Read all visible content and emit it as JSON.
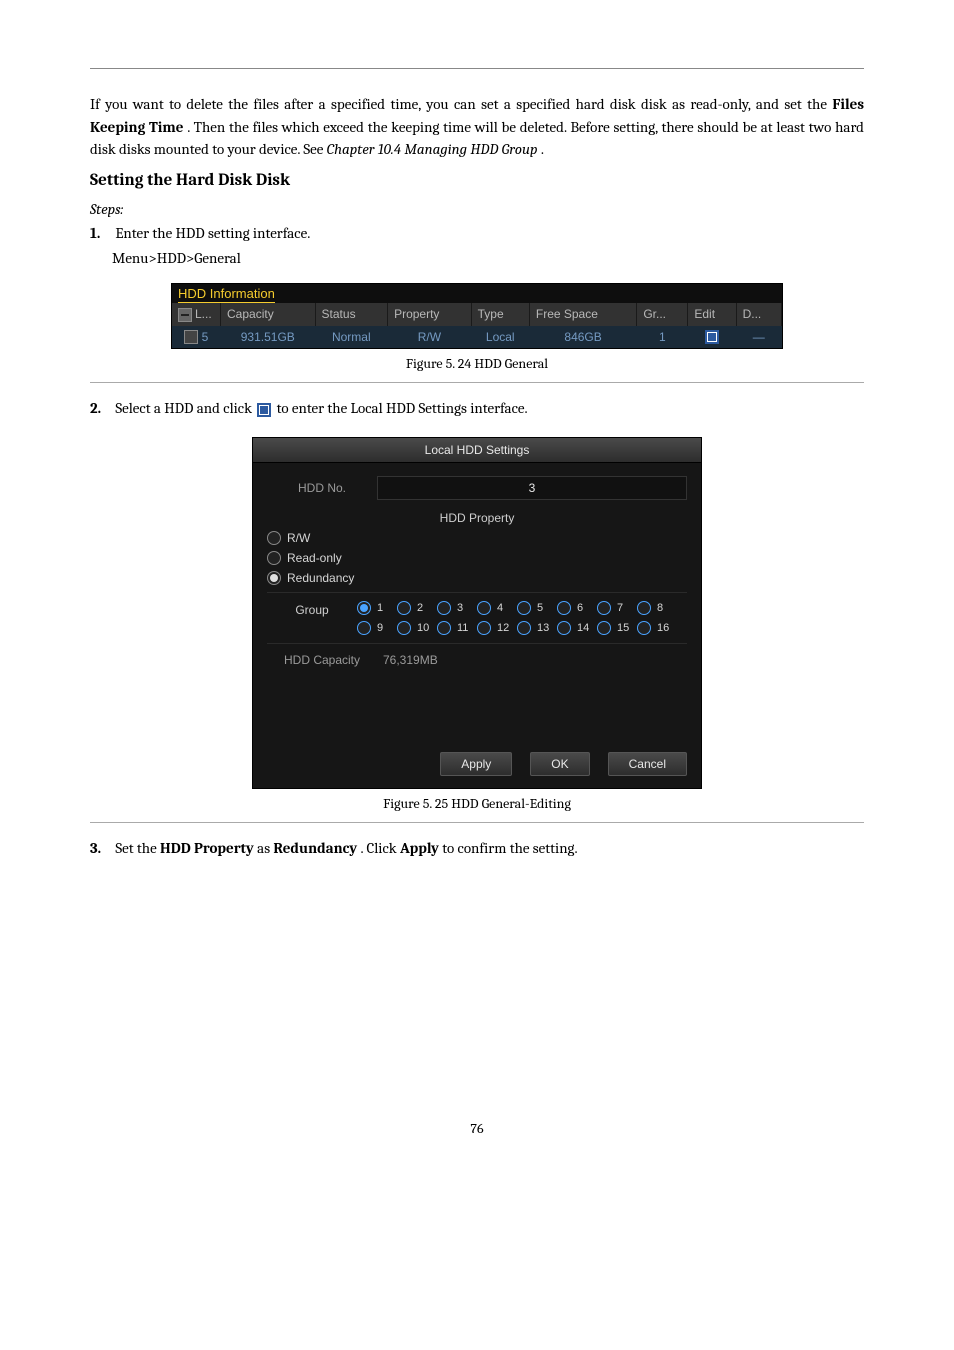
{
  "header_rule": "",
  "intro": {
    "p1_a": "If you want to delete the files after a specified time, you can set a specified hard disk disk as read-only, and set the ",
    "p1_b": "Files Keeping Time",
    "p1_c": ". Then the files which exceed the keeping time will be deleted. Before setting, there should be at least two hard disk disks mounted to your device. See ",
    "p1_d": "Chapter 10.4 Managing HDD Group",
    "p1_e": "."
  },
  "setting_heading": "Setting the Hard Disk Disk",
  "steps_label": "Steps:",
  "step1": {
    "n": "1.",
    "t": "Enter the HDD setting interface."
  },
  "breadcrumb": "Menu>HDD>General",
  "hdd_info": {
    "title": "HDD Information",
    "cols": [
      "L...",
      "Capacity",
      "Status",
      "Property",
      "Type",
      "Free Space",
      "Gr...",
      "Edit",
      "D..."
    ],
    "row": {
      "num": "5",
      "capacity": "931.51GB",
      "status": "Normal",
      "property": "R/W",
      "type": "Local",
      "free": "846GB",
      "group": "1",
      "del": "—"
    }
  },
  "fig1_caption": "Figure 5. 24 HDD General",
  "step2": {
    "n": "2.",
    "a": "Select a HDD and click ",
    "b": " to enter the Local HDD Settings interface."
  },
  "dialog": {
    "title": "Local HDD Settings",
    "hdd_no_label": "HDD No.",
    "hdd_no_value": "3",
    "hdd_property_label": "HDD Property",
    "prop_rw": "R/W",
    "prop_ro": "Read-only",
    "prop_red": "Redundancy",
    "group_label": "Group",
    "groups": [
      "1",
      "2",
      "3",
      "4",
      "5",
      "6",
      "7",
      "8",
      "9",
      "10",
      "11",
      "12",
      "13",
      "14",
      "15",
      "16"
    ],
    "hdd_cap_label": "HDD Capacity",
    "hdd_cap_value": "76,319MB",
    "btn_apply": "Apply",
    "btn_ok": "OK",
    "btn_cancel": "Cancel"
  },
  "fig2_caption": "Figure 5. 25 HDD General-Editing",
  "step3": {
    "n": "3.",
    "a": "Set the ",
    "b": "HDD Property",
    "c": " as ",
    "d": "Redundancy",
    "e": ". Click ",
    "f": "Apply",
    "g": " to confirm the setting."
  },
  "page_number": "76"
}
